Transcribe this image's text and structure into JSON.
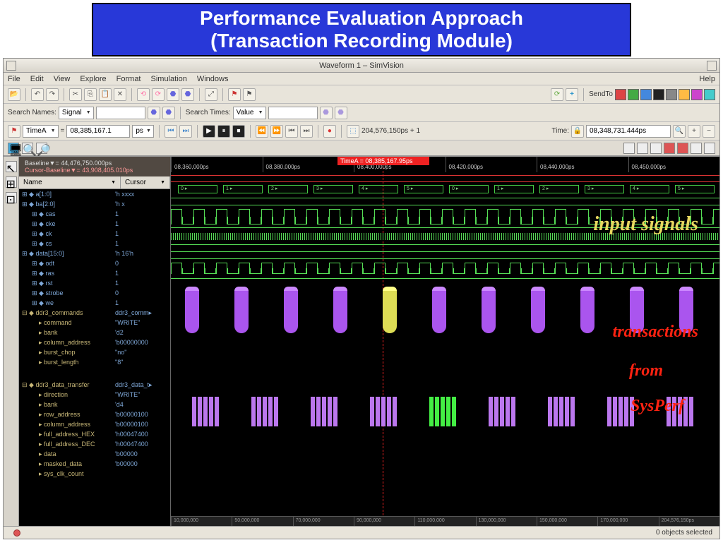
{
  "slide": {
    "title_l1": "Performance Evaluation Approach",
    "title_l2": "(Transaction Recording Module)"
  },
  "window_title": "Waveform 1 – SimVision",
  "menu": {
    "file": "File",
    "edit": "Edit",
    "view": "View",
    "explore": "Explore",
    "format": "Format",
    "simulation": "Simulation",
    "windows": "Windows",
    "help": "Help"
  },
  "search": {
    "names_label": "Search Names:",
    "names_mode": "Signal",
    "times_label": "Search Times:",
    "times_mode": "Value"
  },
  "cursor": {
    "label": "TimeA",
    "value": "08,385,167.1",
    "unit": "ps",
    "range": "204,576,150ps + 1",
    "time_label": "Time:",
    "time_value": "08,348,731.444ps"
  },
  "sendto": "SendTo",
  "baseline": {
    "b": "Baseline▼= 44,476,750.000ps",
    "c": "Cursor-Baseline▼= 43,908,405.010ps"
  },
  "marker": "TimeA = 08,385,167.95ps",
  "time_ticks": [
    "08,360,000ps",
    "08,380,000ps",
    "08,400,000ps",
    "08,420,000ps",
    "08,440,000ps",
    "08,450,000ps"
  ],
  "ruler_ticks": [
    "10,000,000",
    "50,000,000",
    "70,000,000",
    "90,000,000",
    "110,000,000",
    "130,000,000",
    "150,000,000",
    "170,000,000",
    "204,576,150ps"
  ],
  "columns": {
    "name": "Name",
    "cursor": "Cursor"
  },
  "signals": [
    {
      "name": "a[1:0]",
      "val": "'h xxxx"
    },
    {
      "name": "ba[2:0]",
      "val": "'h x"
    },
    {
      "name": "cas",
      "val": "1",
      "in": 1
    },
    {
      "name": "cke",
      "val": "1",
      "in": 1
    },
    {
      "name": "ck",
      "val": "1",
      "in": 1
    },
    {
      "name": "cs",
      "val": "1",
      "in": 1
    },
    {
      "name": "data[15:0]",
      "val": "'h 16'h"
    },
    {
      "name": "odt",
      "val": "0",
      "in": 1
    },
    {
      "name": "ras",
      "val": "1",
      "in": 1
    },
    {
      "name": "rst",
      "val": "1",
      "in": 1
    },
    {
      "name": "strobe",
      "val": "0",
      "in": 1
    },
    {
      "name": "we",
      "val": "1",
      "in": 1
    }
  ],
  "groups": [
    {
      "name": "ddr3_commands",
      "val": "ddr3_comm▸",
      "children": [
        {
          "name": "command",
          "val": "\"WRITE\""
        },
        {
          "name": "bank",
          "val": "'d2"
        },
        {
          "name": "column_address",
          "val": "'b00000000"
        },
        {
          "name": "burst_chop",
          "val": "\"no\""
        },
        {
          "name": "burst_length",
          "val": "\"8\""
        }
      ]
    },
    {
      "name": "ddr3_data_transfer",
      "val": "ddr3_data_t▸",
      "children": [
        {
          "name": "direction",
          "val": "\"WRITE\""
        },
        {
          "name": "bank",
          "val": "'d4"
        },
        {
          "name": "row_address",
          "val": "'b00000100"
        },
        {
          "name": "column_address",
          "val": "'b00000100"
        },
        {
          "name": "full_address_HEX",
          "val": "'h00047400"
        },
        {
          "name": "full_address_DEC",
          "val": "'h00047400"
        },
        {
          "name": "data",
          "val": "'b00000"
        },
        {
          "name": "masked_data",
          "val": "'b00000"
        },
        {
          "name": "sys_clk_count",
          "val": ""
        }
      ]
    }
  ],
  "annotations": {
    "input": "input signals",
    "trans": "transactions",
    "from": "from",
    "sysperf": "SysPerf"
  },
  "status": "0 objects selected"
}
